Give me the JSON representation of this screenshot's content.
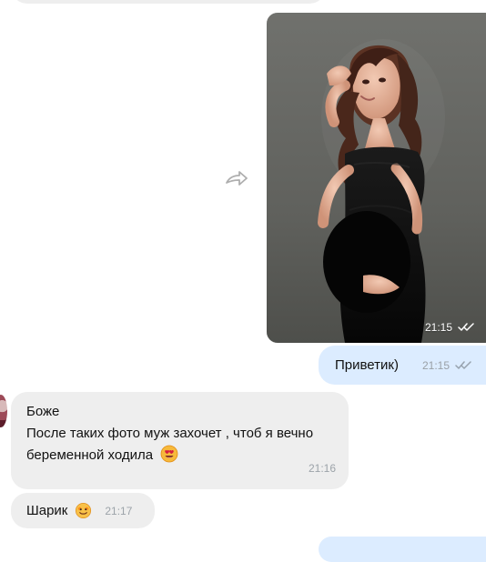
{
  "conversation": {
    "photo_message": {
      "time": "21:15",
      "status_icon": "double-check-icon"
    },
    "outgoing_message": {
      "text": "Приветик)",
      "time": "21:15",
      "status_icon": "double-check-icon"
    },
    "incoming_message": {
      "lines": [
        "Боже",
        "После таких фото муж захочет , чтоб я вечно",
        "беременной ходила"
      ],
      "time": "21:16",
      "emoji_icon": "heart-eyes-emoji"
    },
    "short_message": {
      "text": "Шарик",
      "time": "21:17",
      "emoji_icon": "face-emoji"
    }
  },
  "ui": {
    "forward_icon": "forward-icon",
    "incoming_bubble_color": "#eeeeee",
    "outgoing_bubble_color": "#dcecff",
    "meta_color": "#9aa0a6"
  }
}
